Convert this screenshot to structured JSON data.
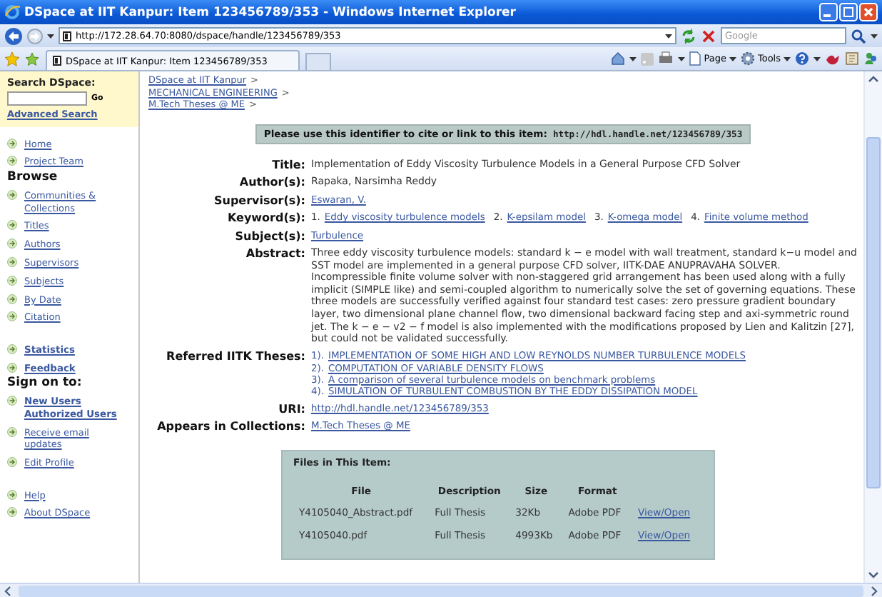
{
  "window": {
    "title": "DSpace at IIT Kanpur: Item 123456789/353 - Windows Internet Explorer"
  },
  "navigation": {
    "address": "http://172.28.64.70:8080/dspace/handle/123456789/353",
    "search": {
      "placeholder": "Google"
    }
  },
  "tabs": [
    {
      "label": "DSpace at IIT Kanpur: Item 123456789/353",
      "selected": true
    }
  ],
  "toolbar": {
    "page_menu": "Page",
    "tools_menu": "Tools"
  },
  "sidebar": {
    "search": {
      "label": "Search DSpace:",
      "button": "Go",
      "advanced": "Advanced Search"
    },
    "sections": [
      {
        "items": [
          {
            "links": [
              "Home"
            ],
            "bold": false
          },
          {
            "links": [
              "Project Team"
            ],
            "bold": false
          }
        ]
      },
      {
        "heading": "Browse",
        "items": [
          {
            "links": [
              "Communities & Collections"
            ],
            "bold": false
          },
          {
            "links": [
              "Titles"
            ],
            "bold": false
          },
          {
            "links": [
              "Authors"
            ],
            "bold": false
          },
          {
            "links": [
              "Supervisors"
            ],
            "bold": false
          },
          {
            "links": [
              "Subjects"
            ],
            "bold": false
          },
          {
            "links": [
              "By Date"
            ],
            "bold": false
          },
          {
            "links": [
              "Citation"
            ],
            "bold": false
          }
        ]
      },
      {
        "items": [
          {
            "links": [
              "Statistics"
            ],
            "bold": true
          },
          {
            "links": [
              "Feedback"
            ],
            "bold": true
          }
        ]
      },
      {
        "heading": "Sign on to:",
        "items": [
          {
            "links": [
              "New Users",
              "Authorized Users"
            ],
            "bold": true
          },
          {
            "links": [
              "Receive email updates"
            ],
            "bold": false
          },
          {
            "links": [
              "Edit Profile"
            ],
            "bold": false
          }
        ]
      },
      {
        "items": [
          {
            "links": [
              "Help"
            ],
            "bold": false
          },
          {
            "links": [
              "About DSpace"
            ],
            "bold": false
          }
        ]
      }
    ]
  },
  "breadcrumbs": [
    {
      "label": "DSpace at IIT Kanpur",
      "separator": ">"
    },
    {
      "label": "MECHANICAL ENGINEERING",
      "separator": ">"
    },
    {
      "label": "M.Tech Theses @ ME",
      "separator": ">"
    }
  ],
  "identifier": {
    "label": "Please use this identifier to cite or link to this item:",
    "url": "http://hdl.handle.net/123456789/353"
  },
  "fields": [
    {
      "label": "Title:",
      "kind": "text",
      "value": "Implementation of Eddy Viscosity Turbulence Models in a General Purpose CFD Solver"
    },
    {
      "label": "Author(s):",
      "kind": "text",
      "value": "Rapaka, Narsimha Reddy"
    },
    {
      "label": "Supervisor(s):",
      "kind": "link",
      "value": "Eswaran, V."
    },
    {
      "label": "Keyword(s):",
      "kind": "keywords",
      "items": [
        {
          "number": "1.",
          "label": "Eddy viscosity turbulence models"
        },
        {
          "number": "2.",
          "label": "K-epsilam model"
        },
        {
          "number": "3.",
          "label": "K-omega model"
        },
        {
          "number": "4.",
          "label": "Finite volume method"
        }
      ]
    },
    {
      "label": "Subject(s):",
      "kind": "link",
      "value": "Turbulence"
    },
    {
      "label": "Abstract:",
      "kind": "text",
      "value": "Three eddy viscosity turbulence models: standard k − e model with wall treatment, standard k−u model and SST model are implemented in a general purpose CFD solver, IITK-DAE ANUPRAVAHA SOLVER. Incompressible finite volume solver with non-staggered grid arrangement has been used along with a fully implicit (SIMPLE like) and semi-coupled algorithm to numerically solve the set of governing equations. These three models are successfully verified against four standard test cases: zero pressure gradient boundary layer, two dimensional plane channel flow, two dimensional backward facing step and axi-symmetric round jet. The k − e − v2 − f model is also implemented with the modifications proposed by Lien and Kalitzin [27], but could not be validated successfully."
    },
    {
      "label": "Referred IITK Theses:",
      "kind": "list",
      "items": [
        {
          "number": "1).",
          "label": "IMPLEMENTATION OF SOME HIGH AND LOW REYNOLDS NUMBER TURBULENCE MODELS"
        },
        {
          "number": "2).",
          "label": "COMPUTATION OF VARIABLE DENSITY FLOWS"
        },
        {
          "number": "3).",
          "label": "A comparison of several turbulence models on benchmark problems"
        },
        {
          "number": "4).",
          "label": "SIMULATION OF TURBULENT COMBUSTION BY THE EDDY DISSIPATION MODEL"
        }
      ]
    },
    {
      "label": "URI:",
      "kind": "link",
      "value": "http://hdl.handle.net/123456789/353"
    },
    {
      "label": "Appears in Collections:",
      "kind": "link",
      "value": "M.Tech Theses @ ME"
    }
  ],
  "files": {
    "title": "Files in This Item:",
    "columns": [
      "File",
      "Description",
      "Size",
      "Format"
    ],
    "rows": [
      {
        "file": "Y4105040_Abstract.pdf",
        "description": "Full Thesis",
        "size": "32Kb",
        "format": "Adobe PDF",
        "link": "View/Open"
      },
      {
        "file": "Y4105040.pdf",
        "description": "Full Thesis",
        "size": "4993Kb",
        "format": "Adobe PDF",
        "link": "View/Open"
      }
    ]
  }
}
